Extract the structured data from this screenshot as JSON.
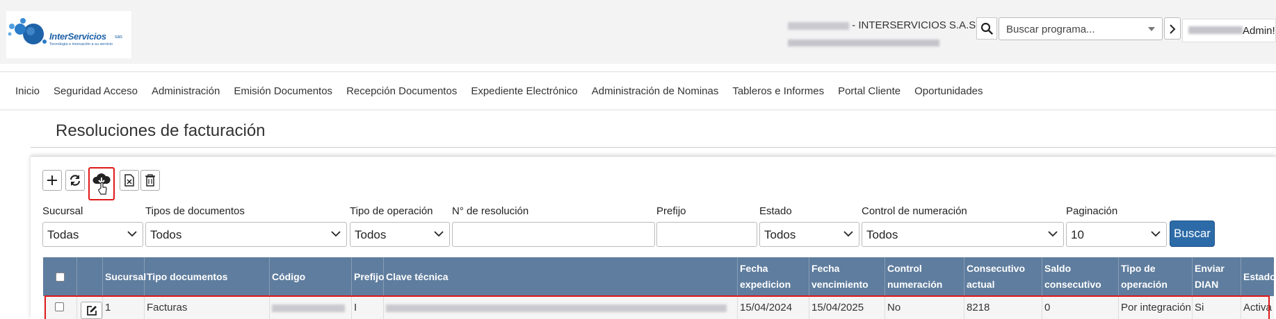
{
  "header": {
    "logo_text": "InterServicios",
    "logo_sas": "sas",
    "logo_tagline": "Tecnología e innovación a su servicio",
    "company_name": "- INTERSERVICIOS S.A.S.",
    "search_placeholder": "Buscar programa...",
    "user_label": "Admin!"
  },
  "menu": {
    "items": [
      "Inicio",
      "Seguridad Acceso",
      "Administración",
      "Emisión Documentos",
      "Recepción Documentos",
      "Expediente Electrónico",
      "Administración de Nominas",
      "Tableros e Informes",
      "Portal Cliente",
      "Oportunidades"
    ]
  },
  "page": {
    "title": "Resoluciones de facturación"
  },
  "filters": {
    "sucursal": {
      "label": "Sucursal",
      "value": "Todas"
    },
    "tipos_documentos": {
      "label": "Tipos de documentos",
      "value": "Todos"
    },
    "tipo_operacion": {
      "label": "Tipo de operación",
      "value": "Todos"
    },
    "num_resolucion": {
      "label": "N° de resolución",
      "value": ""
    },
    "prefijo": {
      "label": "Prefijo",
      "value": ""
    },
    "estado": {
      "label": "Estado",
      "value": "Todos"
    },
    "control_numeracion": {
      "label": "Control de numeración",
      "value": "Todos"
    },
    "paginacion": {
      "label": "Paginación",
      "value": "10"
    },
    "buscar_label": "Buscar"
  },
  "table": {
    "headers": {
      "sucursal": "Sucursal",
      "tipo_documentos": "Tipo documentos",
      "codigo": "Código",
      "prefijo": "Prefijo",
      "clave_tecnica": "Clave técnica",
      "fecha_expedicion": "Fecha expedicion",
      "fecha_vencimiento": "Fecha vencimiento",
      "control_numeracion": "Control numeración",
      "consecutivo_actual": "Consecutivo actual",
      "saldo_consecutivo": "Saldo consecutivo",
      "tipo_operacion": "Tipo de operación",
      "enviar_dian": "Enviar DIAN",
      "estado": "Estado"
    },
    "rows": [
      {
        "sucursal": "1",
        "tipo_documentos": "Facturas",
        "prefijo": "I",
        "fecha_expedicion": "15/04/2024",
        "fecha_vencimiento": "15/04/2025",
        "control_numeracion": "No",
        "consecutivo_actual": "8218",
        "saldo_consecutivo": "0",
        "tipo_operacion": "Por integración",
        "enviar_dian": "Si",
        "estado": "Activa"
      }
    ]
  }
}
